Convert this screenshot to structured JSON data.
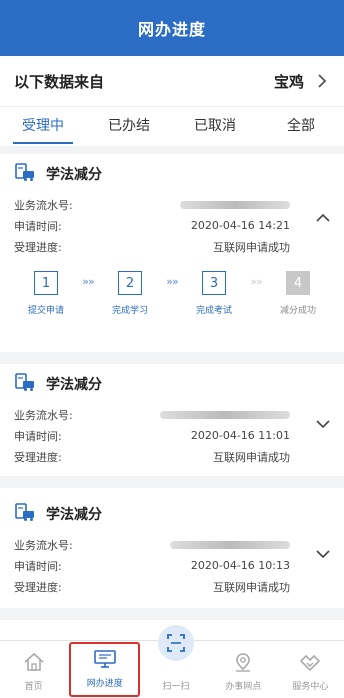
{
  "header": {
    "title": "网办进度"
  },
  "source": {
    "label": "以下数据来自",
    "city": "宝鸡"
  },
  "tabs": [
    {
      "label": "受理中"
    },
    {
      "label": "已办结"
    },
    {
      "label": "已取消"
    },
    {
      "label": "全部"
    }
  ],
  "cards": [
    {
      "title": "学法减分",
      "serial_label": "业务流水号:",
      "serial_value": "",
      "time_label": "申请时间:",
      "time_value": "2020-04-16 14:21",
      "progress_label": "受理进度:",
      "progress_value": "互联网申请成功",
      "steps": [
        {
          "num": "1",
          "label": "提交申请"
        },
        {
          "num": "2",
          "label": "完成学习"
        },
        {
          "num": "3",
          "label": "完成考试"
        },
        {
          "num": "4",
          "label": "减分成功"
        }
      ]
    },
    {
      "title": "学法减分",
      "serial_label": "业务流水号:",
      "serial_value": "",
      "time_label": "申请时间:",
      "time_value": "2020-04-16 11:01",
      "progress_label": "受理进度:",
      "progress_value": "互联网申请成功"
    },
    {
      "title": "学法减分",
      "serial_label": "业务流水号:",
      "serial_value": "",
      "time_label": "申请时间:",
      "time_value": "2020-04-16 10:13",
      "progress_label": "受理进度:",
      "progress_value": "互联网申请成功"
    }
  ],
  "nav": [
    {
      "label": "首页",
      "icon": "home-icon"
    },
    {
      "label": "网办进度",
      "icon": "monitor-icon"
    },
    {
      "label": "扫一扫",
      "icon": "scan-icon"
    },
    {
      "label": "办事网点",
      "icon": "location-icon"
    },
    {
      "label": "服务中心",
      "icon": "service-icon"
    }
  ],
  "colors": {
    "primary": "#2b6cc4",
    "highlight_box": "#d9322a"
  }
}
